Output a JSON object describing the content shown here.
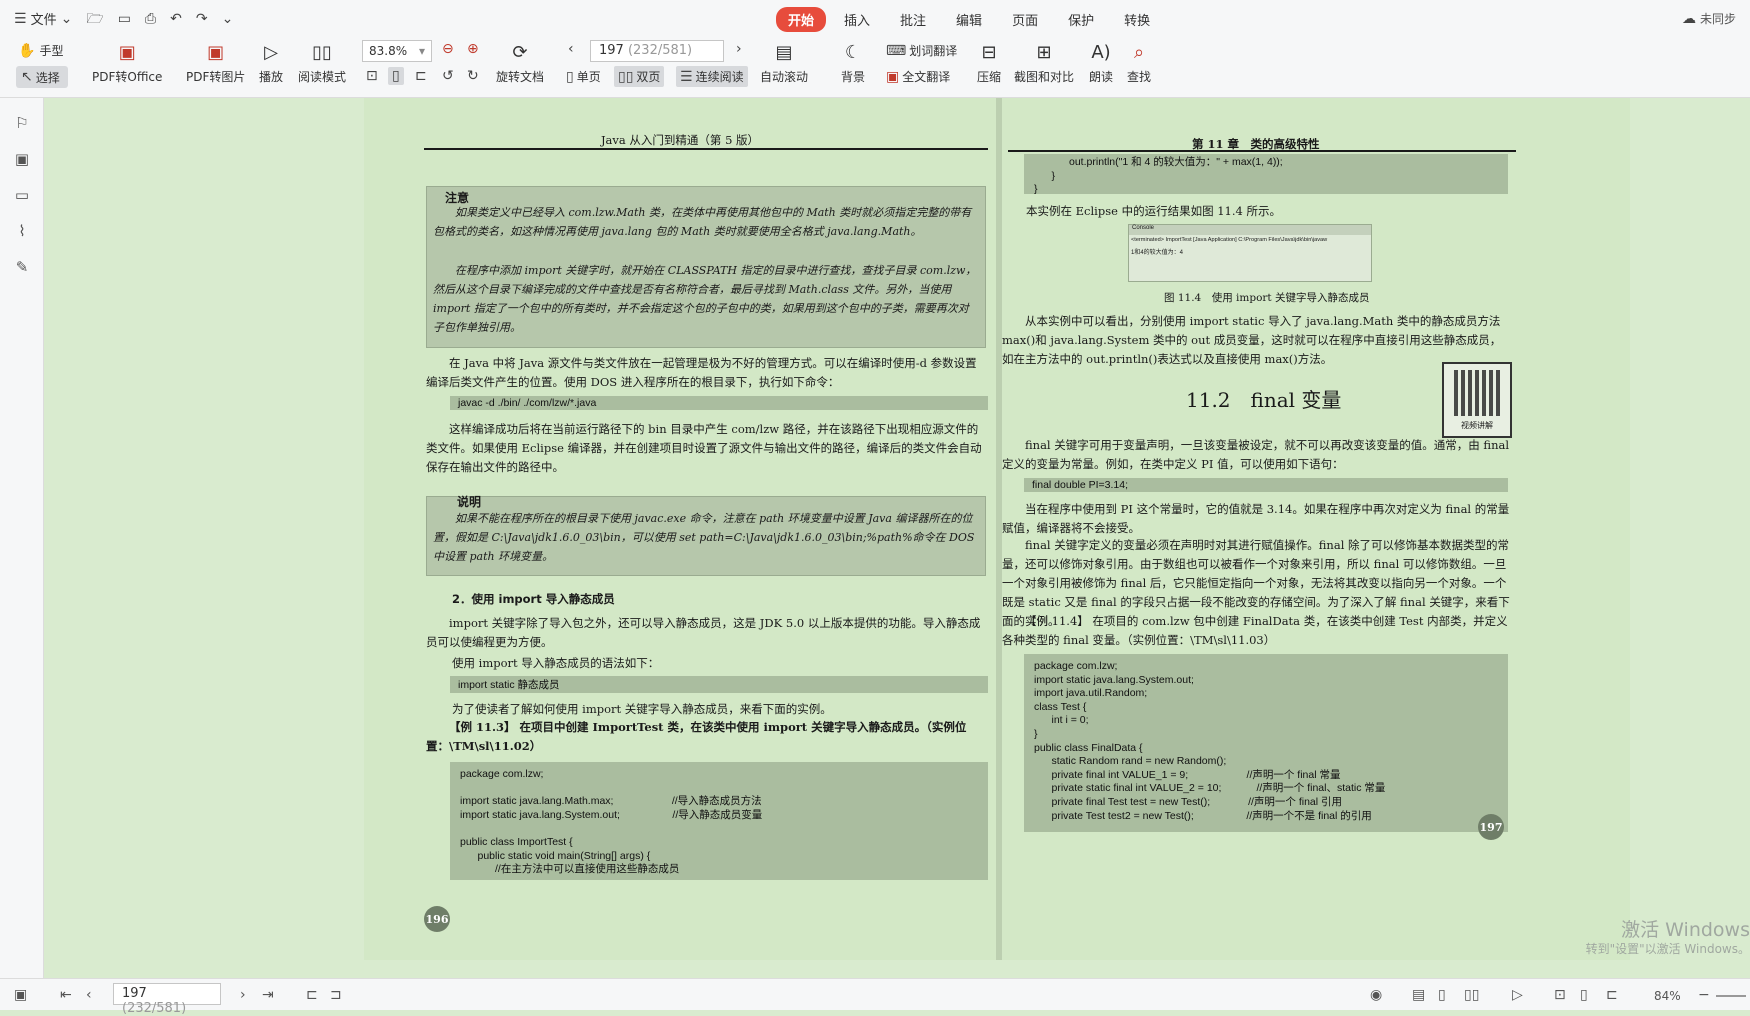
{
  "menu": {
    "file": "文件",
    "tabs": [
      "开始",
      "插入",
      "批注",
      "编辑",
      "页面",
      "保护",
      "转换"
    ],
    "sync": "未同步"
  },
  "ribbon": {
    "hand": "手型",
    "select": "选择",
    "pdf_office": "PDF转Office",
    "pdf_image": "PDF转图片",
    "play": "播放",
    "read_mode": "阅读模式",
    "zoom": "83.8%",
    "rotate": "旋转文档",
    "page_current": "197",
    "page_total": "(232/581)",
    "single": "单页",
    "double": "双页",
    "continuous": "连续阅读",
    "auto_scroll": "自动滚动",
    "background": "背景",
    "word_translate": "划词翻译",
    "full_translate": "全文翻译",
    "compress": "压缩",
    "screenshot_compare": "截图和对比",
    "read_aloud": "朗读",
    "find": "查找"
  },
  "left_page": {
    "header": "Java 从入门到精通（第 5 版）",
    "note_title": "注意",
    "note_p1": "如果类定义中已经导入 com.lzw.Math 类，在类体中再使用其他包中的 Math 类时就必须指定完整的带有包格式的类名，如这种情况再使用 java.lang 包的 Math 类时就要使用全名格式 java.lang.Math。",
    "note_p2": "在程序中添加 import 关键字时，就开始在 CLASSPATH 指定的目录中进行查找，查找子目录 com.lzw，然后从这个目录下编译完成的文件中查找是否有名称符合者，最后寻找到 Math.class 文件。另外，当使用 import 指定了一个包中的所有类时，并不会指定这个包的子包中的类，如果用到这个包中的子类，需要再次对子包作单独引用。",
    "p1": "在 Java 中将 Java 源文件与类文件放在一起管理是极为不好的管理方式。可以在编译时使用-d 参数设置编译后类文件产生的位置。使用 DOS 进入程序所在的根目录下，执行如下命令：",
    "cmd": "javac -d ./bin/ ./com/lzw/*.java",
    "p2": "这样编译成功后将在当前运行路径下的 bin 目录中产生 com/lzw 路径，并在该路径下出现相应源文件的类文件。如果使用 Eclipse 编译器，并在创建项目时设置了源文件与输出文件的路径，编译后的类文件会自动保存在输出文件的路径中。",
    "note2_title": "说明",
    "note2_p": "如果不能在程序所在的根目录下使用 javac.exe 命令，注意在 path 环境变量中设置 Java 编译器所在的位置，假如是 C:\\Java\\jdk1.6.0_03\\bin，可以使用 set path=C:\\Java\\jdk1.6.0_03\\bin;%path%命令在 DOS 中设置 path 环境变量。",
    "section": "2．使用 import 导入静态成员",
    "p3": "import 关键字除了导入包之外，还可以导入静态成员，这是 JDK 5.0 以上版本提供的功能。导入静态成员可以使编程更为方便。",
    "p4": "使用 import 导入静态成员的语法如下：",
    "syntax": "import static 静态成员",
    "p5": "为了使读者了解如何使用 import 关键字导入静态成员，来看下面的实例。",
    "example": "【例 11.3】 在项目中创建 ImportTest 类，在该类中使用 import 关键字导入静态成员。（实例位置：\\TM\\sl\\11.02）",
    "code": "package com.lzw;\n\nimport static java.lang.Math.max;                    //导入静态成员方法\nimport static java.lang.System.out;                  //导入静态成员变量\n\npublic class ImportTest {\n      public static void main(String[] args) {\n            //在主方法中可以直接使用这些静态成员",
    "page_num": "196"
  },
  "right_page": {
    "header": "第 11 章　类的高级特性",
    "code_top": "            out.println(\"1 和 4 的较大值为：\" + max(1, 4));\n      }\n}",
    "p1": "本实例在 Eclipse 中的运行结果如图 11.4 所示。",
    "console_tab": "Console",
    "console_line1": "<terminated> ImportTest [Java Application] C:\\Program Files\\Java\\jdk\\bin\\javaw",
    "console_line2": "1和4的较大值为：4",
    "fig_caption": "图 11.4　使用 import 关键字导入静态成员",
    "p2": "从本实例中可以看出，分别使用 import static 导入了 java.lang.Math 类中的静态成员方法 max()和 java.lang.System 类中的 out 成员变量，这时就可以在程序中直接引用这些静态成员，如在主方法中的 out.println()表达式以及直接使用 max()方法。",
    "h2": "11.2　final 变量",
    "qr_label": "视频讲解",
    "p3": "final 关键字可用于变量声明，一旦该变量被设定，就不可以再改变该变量的值。通常，由 final 定义的变量为常量。例如，在类中定义 PI 值，可以使用如下语句：",
    "code_line": "final double PI=3.14;",
    "p4": "当在程序中使用到 PI 这个常量时，它的值就是 3.14。如果在程序中再次对定义为 final 的常量赋值，编译器将不会接受。",
    "p5": "final 关键字定义的变量必须在声明时对其进行赋值操作。final 除了可以修饰基本数据类型的常量，还可以修饰对象引用。由于数组也可以被看作一个对象来引用，所以 final 可以修饰数组。一旦一个对象引用被修饰为 final 后，它只能恒定指向一个对象，无法将其改变以指向另一个对象。一个既是 static 又是 final 的字段只占据一段不能改变的存储空间。为了深入了解 final 关键字，来看下面的实例。",
    "example": "【例 11.4】 在项目的 com.lzw 包中创建 FinalData 类，在该类中创建 Test 内部类，并定义各种类型的 final 变量。（实例位置：\\TM\\sl\\11.03）",
    "code": "package com.lzw;\nimport static java.lang.System.out;\nimport java.util.Random;\nclass Test {\n      int i = 0;\n}\npublic class FinalData {\n      static Random rand = new Random();\n      private final int VALUE_1 = 9;                    //声明一个 final 常量\n      private static final int VALUE_2 = 10;            //声明一个 final、static 常量\n      private final Test test = new Test();             //声明一个 final 引用\n      private Test test2 = new Test();                  //声明一个不是 final 的引用",
    "page_num": "197"
  },
  "status": {
    "page_current": "197",
    "page_total": "(232/581)",
    "zoom": "84%"
  },
  "watermark": {
    "line1": "激活 Windows",
    "line2": "转到\"设置\"以激活 Windows。"
  }
}
